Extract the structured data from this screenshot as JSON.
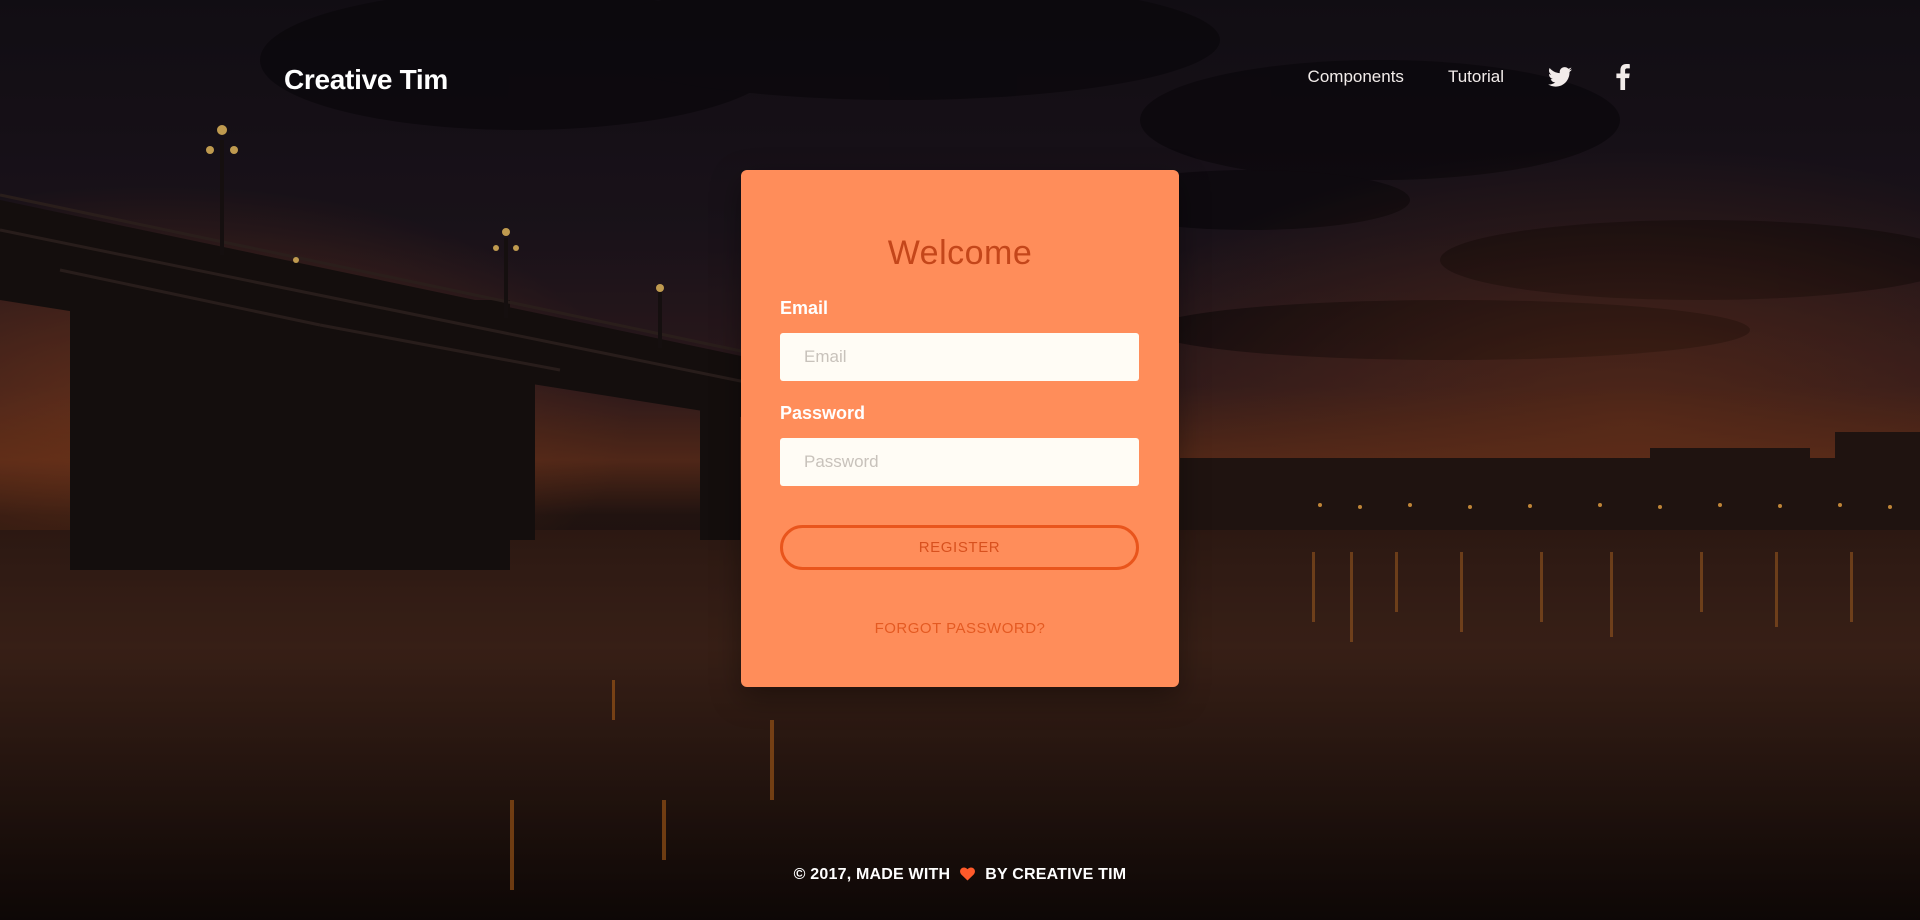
{
  "navbar": {
    "brand": "Creative Tim",
    "links": [
      {
        "label": "Components"
      },
      {
        "label": "Tutorial"
      }
    ],
    "social": [
      {
        "icon": "twitter-icon"
      },
      {
        "icon": "facebook-icon"
      }
    ]
  },
  "card": {
    "title": "Welcome",
    "email_label": "Email",
    "email_placeholder": "Email",
    "email_value": "",
    "password_label": "Password",
    "password_placeholder": "Password",
    "password_value": "",
    "register_label": "REGISTER",
    "forgot_label": "FORGOT PASSWORD?"
  },
  "footer": {
    "prefix": "© 2017, MADE WITH",
    "icon": "heart-icon",
    "suffix": "BY CREATIVE TIM"
  },
  "colors": {
    "card_bg": "#ff8d5a",
    "accent": "#e9551c",
    "title": "#c4461a",
    "input_bg": "#fffcf5",
    "heart": "#ff5a2a"
  }
}
